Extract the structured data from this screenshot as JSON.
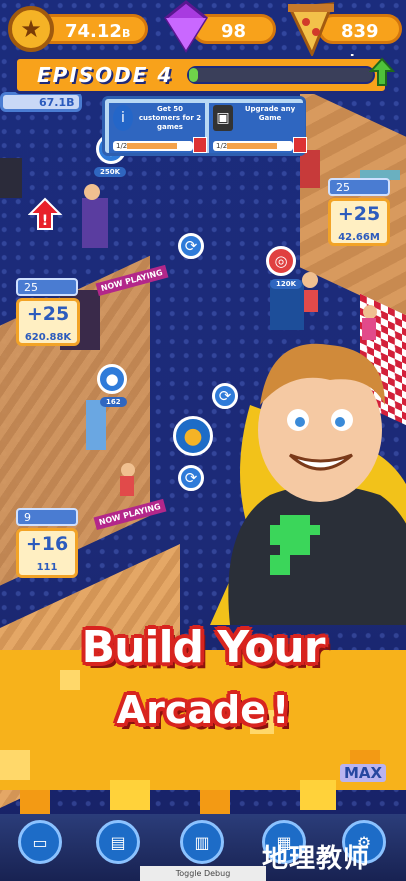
{
  "hud": {
    "coins": "74.12",
    "coins_suffix": "B",
    "gems": "98",
    "pizza": "839"
  },
  "episode": {
    "title": "EPISODE 4",
    "progress": 0.05
  },
  "tasks": [
    {
      "text": "Get 50 customers for 2 games",
      "progress": "1/2"
    },
    {
      "text": "Upgrade any Game",
      "progress": "1/2"
    }
  ],
  "stats": {
    "topleft": {
      "value": "67.1B"
    },
    "right": {
      "count": "25",
      "plus": "+25",
      "amount": "42.66M"
    },
    "left": {
      "count": "25",
      "plus": "+25",
      "amount": "620.88K"
    },
    "bottomleft": {
      "count": "9",
      "plus": "+16",
      "amount": "111"
    }
  },
  "bubbles": {
    "b1": "250K",
    "b2": "120K",
    "b3": "162"
  },
  "signs": {
    "now_playing": "NOW PLAYING"
  },
  "tagline": {
    "line1": "Build Your",
    "line2": "Arcade",
    "exclaim": "!"
  },
  "max_label": "MAX",
  "toggle_label": "Toggle Debug",
  "watermark": "地理教师",
  "colors": {
    "hud_orange": "#f8a21b",
    "progress_green": "#6fd24a",
    "title_red": "#d8241f",
    "stat_blue": "#2c5bbd"
  },
  "icons": [
    "coin-icon",
    "gem-icon",
    "pizza-icon",
    "upgrade-arrow-icon",
    "person-icon",
    "coin-small-icon",
    "refresh-icon",
    "alert-icon"
  ]
}
